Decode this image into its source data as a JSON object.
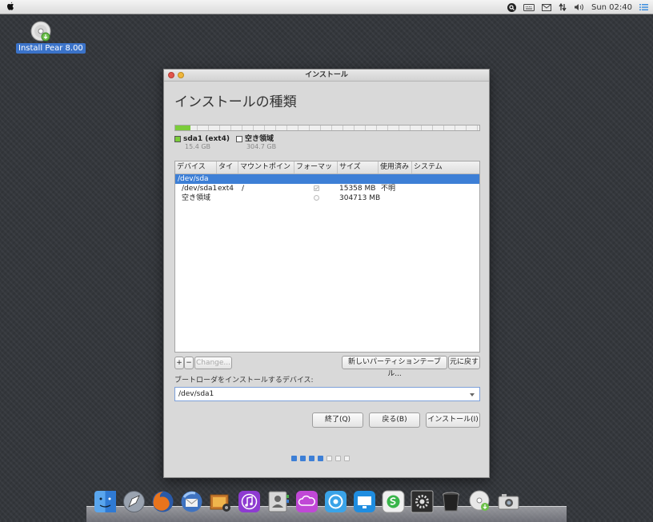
{
  "menubar": {
    "clock": "Sun 02:40",
    "icons": [
      "apple-logo-icon",
      "search-icon",
      "keyboard-icon",
      "mail-icon",
      "network-icon",
      "volume-icon",
      "list-icon"
    ]
  },
  "desktop": {
    "install_icon_label": "Install Pear 8.00"
  },
  "window": {
    "title": "インストール",
    "heading": "インストールの種類",
    "partition_bar": {
      "used_fraction": 0.05
    },
    "legend": [
      {
        "name": "sda1 (ext4)",
        "size": "15.4 GB",
        "color": "#7bcc3a"
      },
      {
        "name": "空き領域",
        "size": "304.7 GB",
        "color": "#ffffff"
      }
    ],
    "table": {
      "columns": [
        "デバイス",
        "タイプ",
        "マウントポイント",
        "フォーマット",
        "サイズ",
        "使用済み",
        "システム"
      ],
      "rows": [
        {
          "device": "/dev/sda",
          "type": "",
          "mount": "",
          "format": "",
          "size": "",
          "used": "",
          "system": ""
        },
        {
          "device": "/dev/sda1",
          "type": "ext4",
          "mount": "/",
          "format": "checked",
          "size": "15358 MB",
          "used": "不明",
          "system": ""
        },
        {
          "device": "空き領域",
          "type": "",
          "mount": "",
          "format": "unchecked",
          "size": "304713 MB",
          "used": "",
          "system": ""
        }
      ]
    },
    "toolbar": {
      "add_label": "+",
      "remove_label": "−",
      "change_label": "Change...",
      "new_table_label": "新しいパーティションテーブル...",
      "revert_label": "元に戻す"
    },
    "bootloader": {
      "label": "ブートローダをインストールするデバイス:",
      "value": "/dev/sda1"
    },
    "buttons": {
      "quit": "終了(Q)",
      "back": "戻る(B)",
      "install": "インストール(I)"
    },
    "progress": {
      "total": 7,
      "current": 4
    }
  },
  "dock": {
    "items": [
      "finder-icon",
      "launchpad-icon",
      "firefox-icon",
      "thunderbird-icon",
      "photos-icon",
      "music-icon",
      "contacts-icon",
      "cloud-icon",
      "software-center-icon",
      "screen-sharing-icon",
      "skype-icon",
      "system-settings-icon",
      "trash-icon",
      "installer-disc-icon",
      "camera-icon"
    ]
  },
  "colors": {
    "accent": "#3d7fd6",
    "used_partition": "#7bcc3a"
  }
}
